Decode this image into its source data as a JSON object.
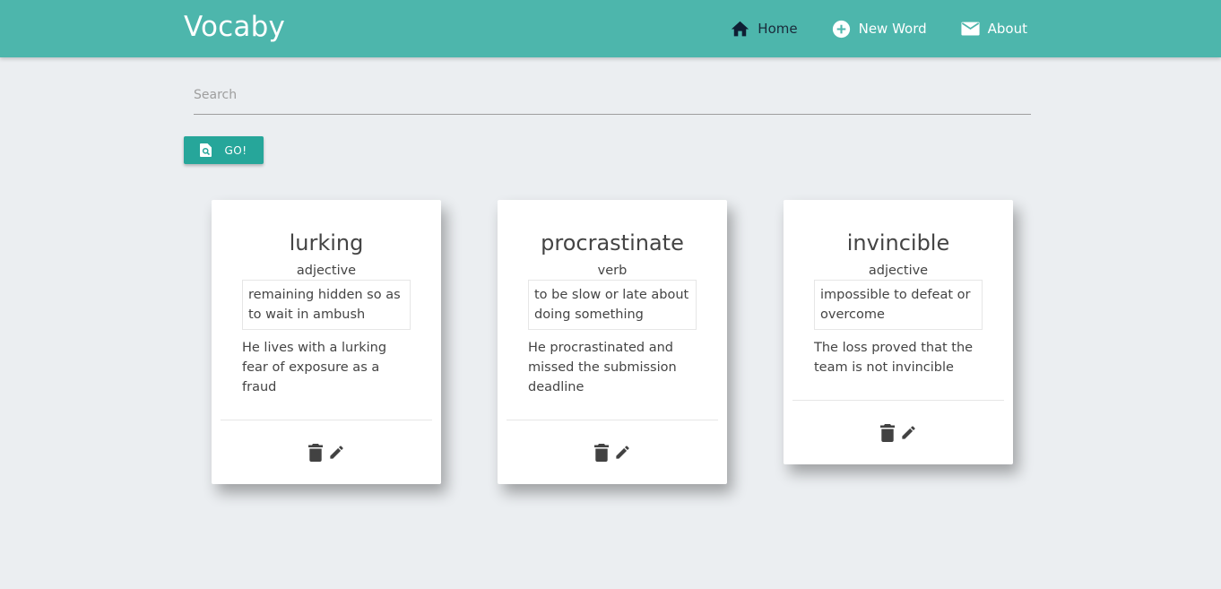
{
  "app": {
    "brand": "Vocaby",
    "accent": "#4db6ac",
    "button_color": "#26a69a"
  },
  "nav": {
    "items": [
      {
        "label": "Home",
        "icon": "home-icon"
      },
      {
        "label": "New Word",
        "icon": "add-circle-icon"
      },
      {
        "label": "About",
        "icon": "mail-icon"
      }
    ]
  },
  "search": {
    "placeholder": "Search",
    "value": "",
    "button_label": "GO!",
    "button_icon": "find-in-page-icon"
  },
  "cards": [
    {
      "word": "lurking",
      "pos": "adjective",
      "definition": "remaining hidden so as to wait in ambush",
      "example": "He lives with a lurking fear of exposure as a fraud"
    },
    {
      "word": "procrastinate",
      "pos": "verb",
      "definition": "to be slow or late about doing something",
      "example": "He procrastinated and missed the submission deadline"
    },
    {
      "word": "invincible",
      "pos": "adjective",
      "definition": "impossible to defeat or overcome",
      "example": "The loss proved that the team is not invincible"
    }
  ],
  "card_actions": {
    "delete_icon": "trash-icon",
    "edit_icon": "pencil-icon"
  }
}
